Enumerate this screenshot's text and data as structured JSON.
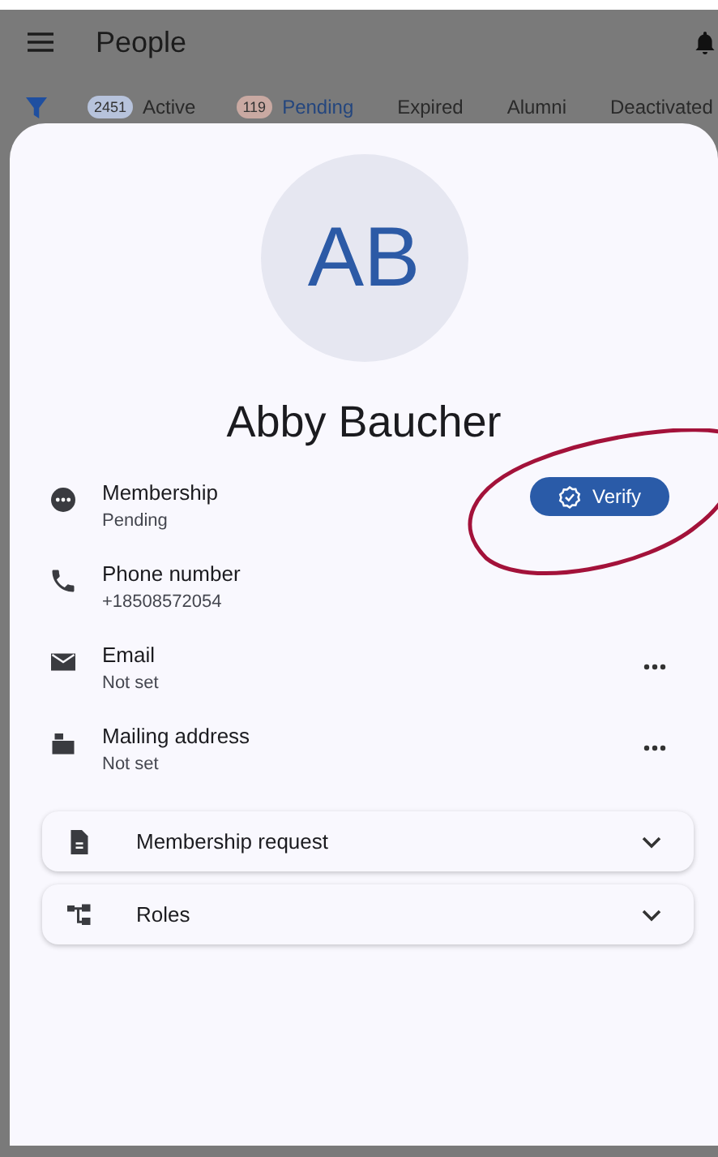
{
  "app_bar": {
    "title": "People"
  },
  "filter_tabs": [
    {
      "count": "2451",
      "color": "#b7c3dc",
      "label": "Active",
      "selected": false
    },
    {
      "count": "119",
      "color": "#c9a9a2",
      "label": "Pending",
      "selected": true
    },
    {
      "label": "Expired",
      "selected": false
    },
    {
      "label": "Alumni",
      "selected": false
    },
    {
      "label": "Deactivated",
      "selected": false
    }
  ],
  "profile": {
    "initials": "AB",
    "name": "Abby Baucher"
  },
  "fields": [
    {
      "kind": "membership",
      "label": "Membership",
      "value": "Pending",
      "action": "Verify",
      "circled": true
    },
    {
      "kind": "phone",
      "label": "Phone number",
      "value": "+18508572054"
    },
    {
      "kind": "email",
      "label": "Email",
      "value": "Not set",
      "more": true
    },
    {
      "kind": "address",
      "label": "Mailing address",
      "value": "Not set",
      "more": true
    }
  ],
  "sections": [
    {
      "kind": "request",
      "label": "Membership request",
      "expanded": false
    },
    {
      "kind": "roles",
      "label": "Roles",
      "expanded": false
    }
  ]
}
